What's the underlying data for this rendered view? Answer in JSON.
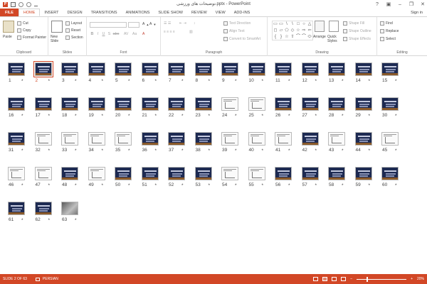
{
  "app": {
    "logo": "P",
    "window_title": "توضیحات های ورزشی.pptx - PowerPoint",
    "help": "?",
    "minimize": "–",
    "restore": "❐",
    "close": "✕",
    "signin": "Sign in"
  },
  "tabs": [
    {
      "label": "FILE"
    },
    {
      "label": "HOME"
    },
    {
      "label": "INSERT"
    },
    {
      "label": "DESIGN"
    },
    {
      "label": "TRANSITIONS"
    },
    {
      "label": "ANIMATIONS"
    },
    {
      "label": "SLIDE SHOW"
    },
    {
      "label": "REVIEW"
    },
    {
      "label": "VIEW"
    },
    {
      "label": "ADD-INS"
    }
  ],
  "ribbon": {
    "clipboard": {
      "label": "Clipboard",
      "paste": "Paste",
      "cut": "Cut",
      "copy": "Copy",
      "format_painter": "Format Painter"
    },
    "slides": {
      "label": "Slides",
      "new_slide": "New Slide",
      "layout": "Layout",
      "reset": "Reset",
      "section": "Section"
    },
    "font": {
      "label": "Font",
      "bold": "B",
      "italic": "I",
      "underline": "U",
      "shadow": "S",
      "strike": "abc"
    },
    "paragraph": {
      "label": "Paragraph",
      "text_direction": "Text Direction",
      "align_text": "Align Text",
      "convert_smartart": "Convert to SmartArt"
    },
    "drawing": {
      "label": "Drawing",
      "arrange": "Arrange",
      "quick_styles": "Quick Styles",
      "shape_fill": "Shape Fill",
      "shape_outline": "Shape Outline",
      "shape_effects": "Shape Effects"
    },
    "editing": {
      "label": "Editing",
      "find": "Find",
      "replace": "Replace",
      "select": "Select"
    }
  },
  "shapes": [
    "▭",
    "▭",
    "\\",
    "\\",
    "□",
    "○",
    "△",
    "◻",
    "▱",
    "⬠",
    "◇",
    "☆",
    "⇨",
    "⇦",
    "{",
    "}",
    "☆",
    "⇧",
    "⌒",
    "⌒",
    "⬭"
  ],
  "slides": [
    {
      "n": "1",
      "t": "dark"
    },
    {
      "n": "2",
      "t": "dark"
    },
    {
      "n": "3",
      "t": "dark"
    },
    {
      "n": "4",
      "t": "dark"
    },
    {
      "n": "5",
      "t": "dark"
    },
    {
      "n": "6",
      "t": "dark"
    },
    {
      "n": "7",
      "t": "dark"
    },
    {
      "n": "8",
      "t": "dark"
    },
    {
      "n": "9",
      "t": "dark"
    },
    {
      "n": "10",
      "t": "dark"
    },
    {
      "n": "11",
      "t": "dark"
    },
    {
      "n": "12",
      "t": "dark"
    },
    {
      "n": "13",
      "t": "dark"
    },
    {
      "n": "14",
      "t": "dark"
    },
    {
      "n": "15",
      "t": "dark"
    },
    {
      "n": "16",
      "t": "dark"
    },
    {
      "n": "17",
      "t": "dark"
    },
    {
      "n": "18",
      "t": "dark"
    },
    {
      "n": "19",
      "t": "dark"
    },
    {
      "n": "20",
      "t": "dark"
    },
    {
      "n": "21",
      "t": "dark"
    },
    {
      "n": "22",
      "t": "dark"
    },
    {
      "n": "23",
      "t": "dark"
    },
    {
      "n": "24",
      "t": "light"
    },
    {
      "n": "25",
      "t": "light"
    },
    {
      "n": "26",
      "t": "dark"
    },
    {
      "n": "27",
      "t": "dark"
    },
    {
      "n": "28",
      "t": "dark"
    },
    {
      "n": "29",
      "t": "dark"
    },
    {
      "n": "30",
      "t": "dark"
    },
    {
      "n": "31",
      "t": "dark"
    },
    {
      "n": "32",
      "t": "light"
    },
    {
      "n": "33",
      "t": "light"
    },
    {
      "n": "34",
      "t": "light"
    },
    {
      "n": "35",
      "t": "light"
    },
    {
      "n": "36",
      "t": "dark"
    },
    {
      "n": "37",
      "t": "dark"
    },
    {
      "n": "38",
      "t": "dark"
    },
    {
      "n": "39",
      "t": "light"
    },
    {
      "n": "40",
      "t": "light"
    },
    {
      "n": "41",
      "t": "light"
    },
    {
      "n": "42",
      "t": "dark"
    },
    {
      "n": "43",
      "t": "light"
    },
    {
      "n": "44",
      "t": "dark"
    },
    {
      "n": "45",
      "t": "light"
    },
    {
      "n": "46",
      "t": "light"
    },
    {
      "n": "47",
      "t": "light"
    },
    {
      "n": "48",
      "t": "dark"
    },
    {
      "n": "49",
      "t": "light"
    },
    {
      "n": "50",
      "t": "dark"
    },
    {
      "n": "51",
      "t": "dark"
    },
    {
      "n": "52",
      "t": "dark"
    },
    {
      "n": "53",
      "t": "dark"
    },
    {
      "n": "54",
      "t": "light"
    },
    {
      "n": "55",
      "t": "light"
    },
    {
      "n": "56",
      "t": "dark"
    },
    {
      "n": "57",
      "t": "dark"
    },
    {
      "n": "58",
      "t": "dark"
    },
    {
      "n": "59",
      "t": "dark"
    },
    {
      "n": "60",
      "t": "dark"
    },
    {
      "n": "61",
      "t": "dark"
    },
    {
      "n": "62",
      "t": "dark"
    },
    {
      "n": "63",
      "t": "photo"
    }
  ],
  "slide_star": "*",
  "selected_slide": 2,
  "status": {
    "slide_info": "SLIDE 2 OF 63",
    "language": "PERSIAN",
    "zoom_minus": "–",
    "zoom_plus": "+",
    "zoom": "20%",
    "zoom_level": 0.2
  },
  "colors": {
    "accent": "#d24726",
    "slide_dark": "#1d2a52"
  }
}
